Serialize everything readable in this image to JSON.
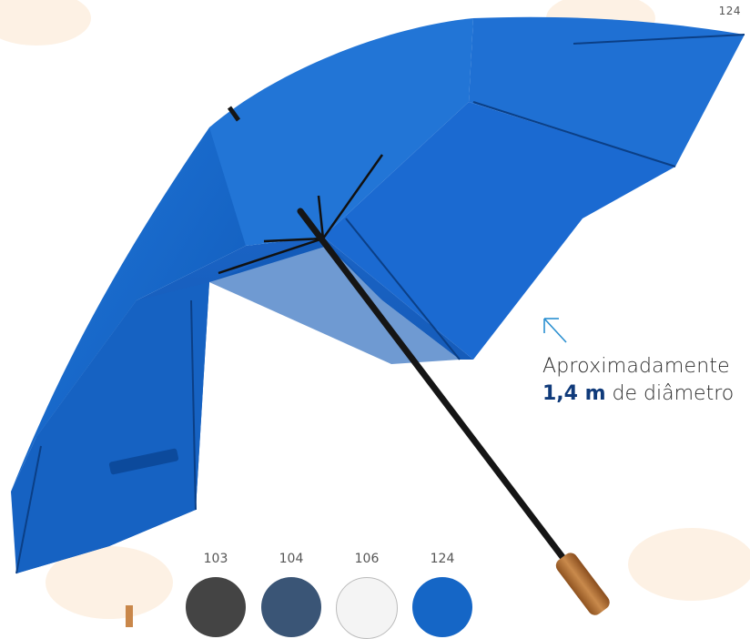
{
  "product": {
    "code": "124"
  },
  "callout": {
    "line1": "Aproximadamente",
    "size": "1,4 m",
    "suffix": " de diâmetro",
    "arrow_icon": "arrow-up-left-icon"
  },
  "colors": [
    {
      "code": "103",
      "hex": "#444444"
    },
    {
      "code": "104",
      "hex": "#3a5576"
    },
    {
      "code": "106",
      "hex": "#f4f4f4"
    },
    {
      "code": "124",
      "hex": "#1566c6"
    }
  ],
  "umbrella": {
    "canopy_color": "#1566c6",
    "handle_color": "#b9753a"
  }
}
